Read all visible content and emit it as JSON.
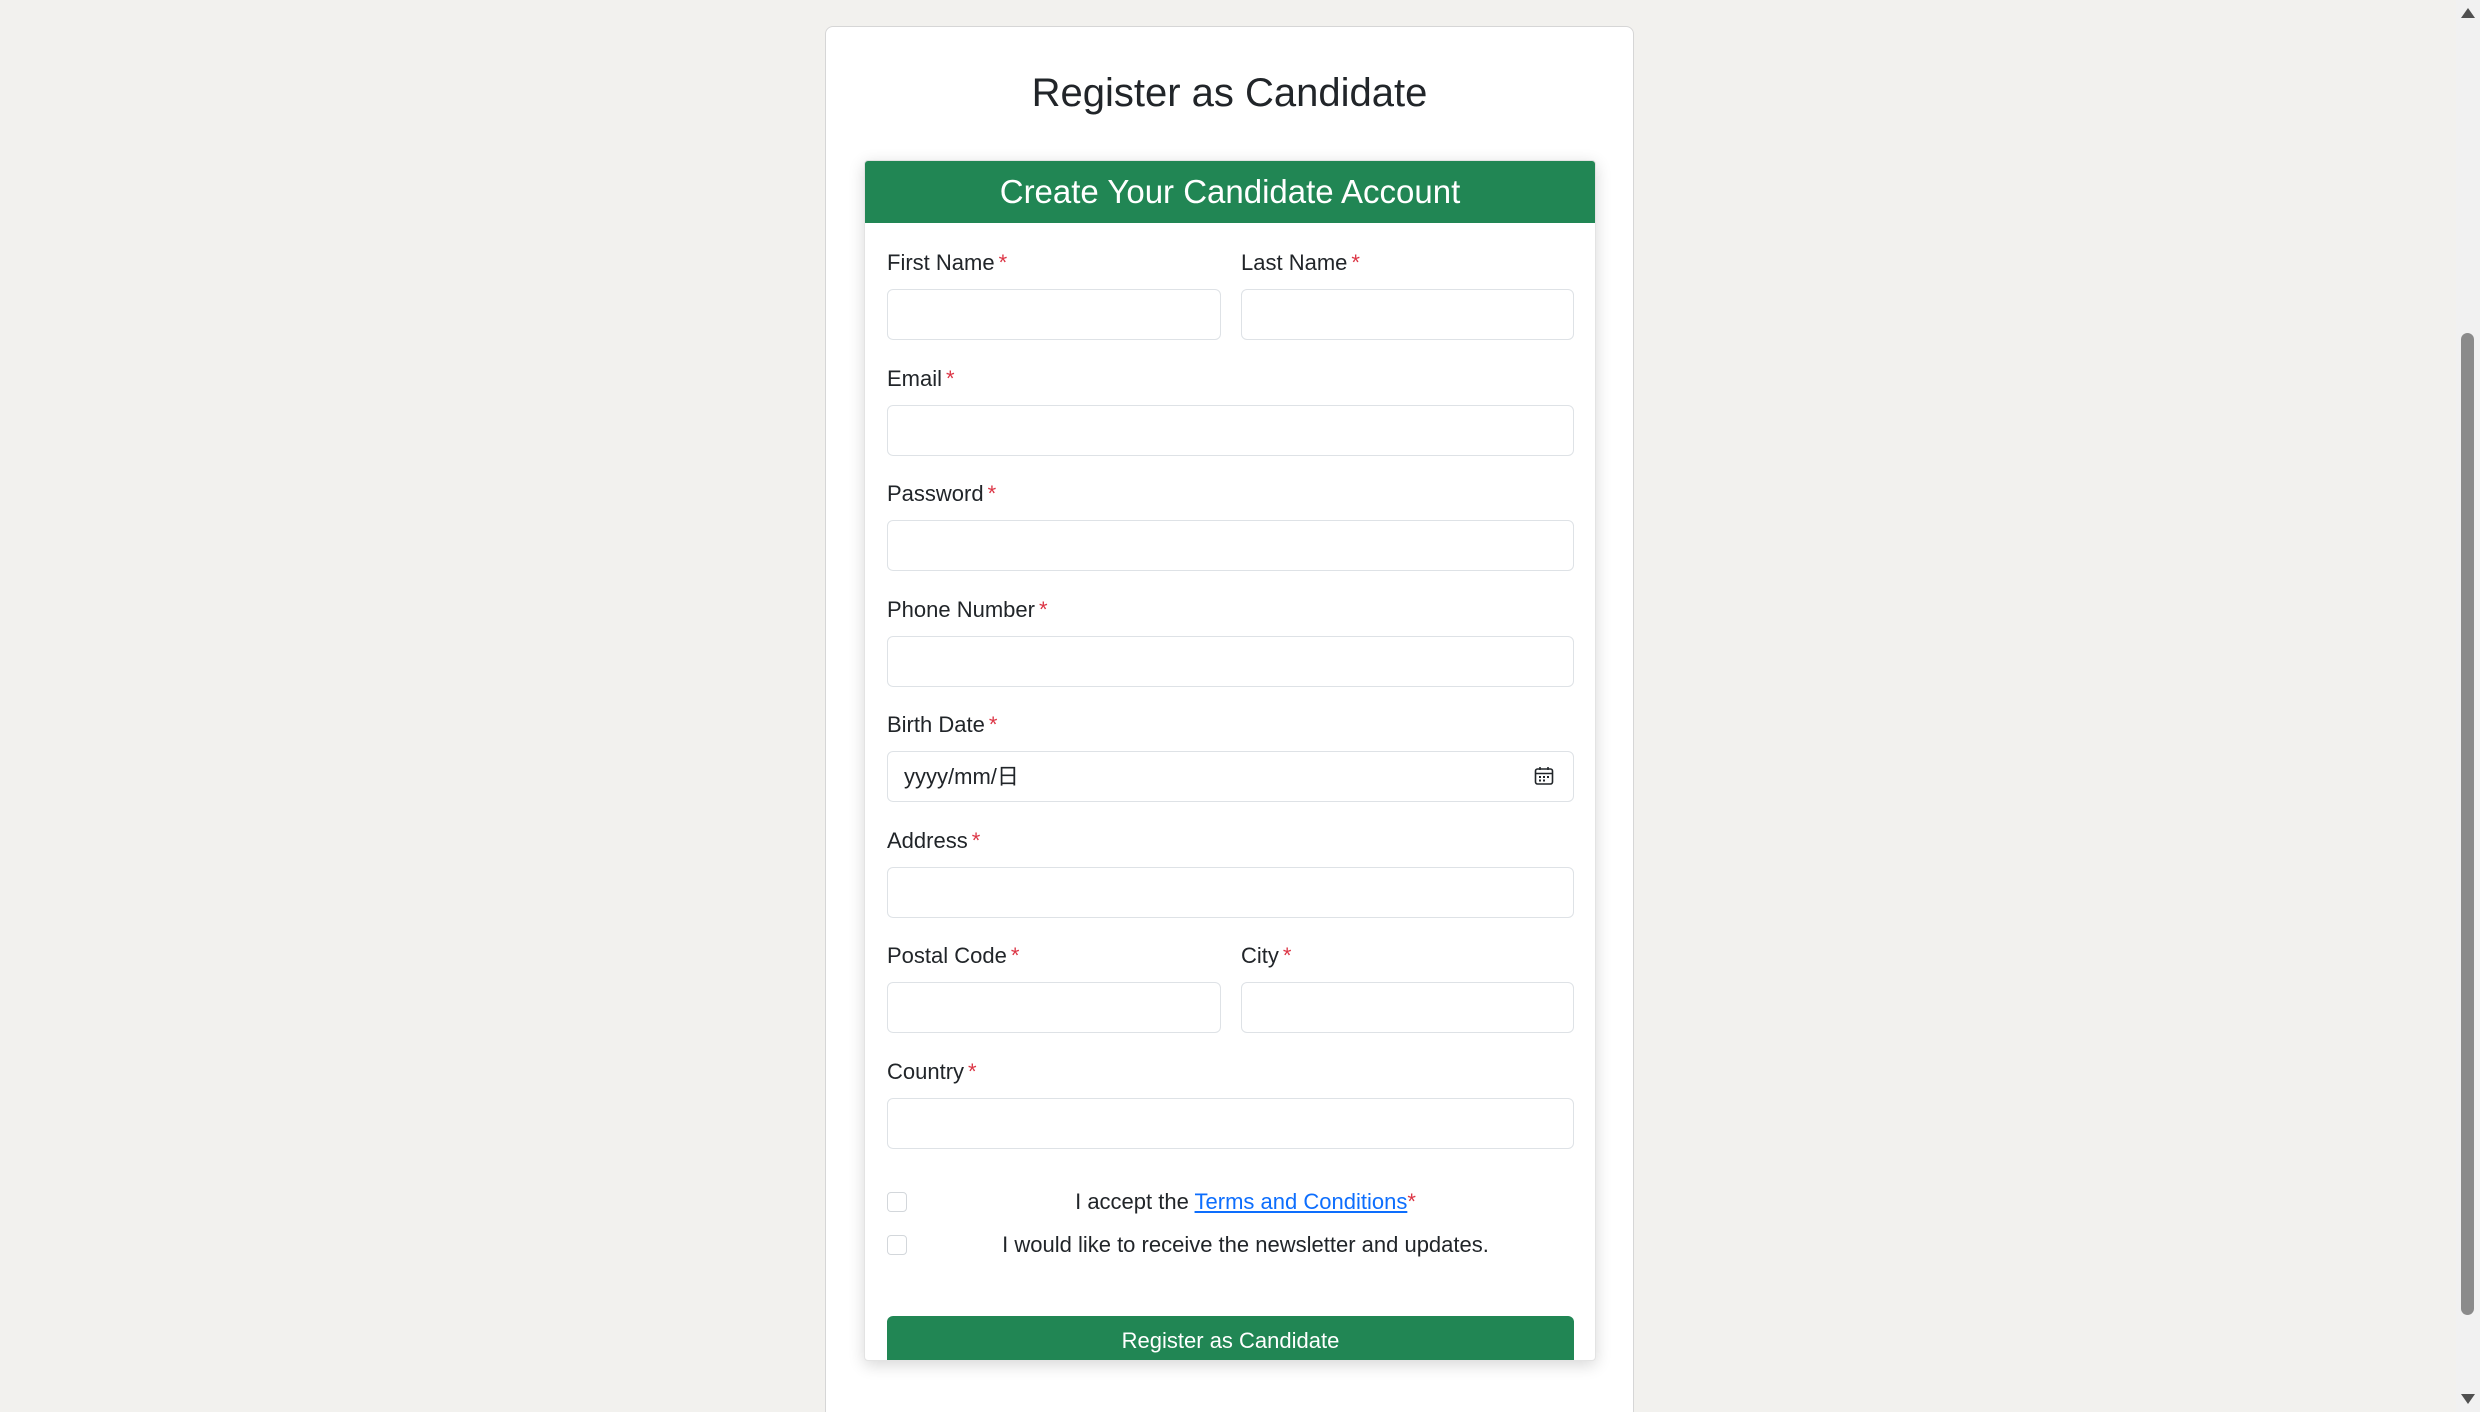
{
  "page": {
    "title": "Register as Candidate"
  },
  "form": {
    "header": "Create Your Candidate Account",
    "required_marker": "*",
    "fields": {
      "first_name": {
        "label": "First Name",
        "value": ""
      },
      "last_name": {
        "label": "Last Name",
        "value": ""
      },
      "email": {
        "label": "Email",
        "value": ""
      },
      "password": {
        "label": "Password",
        "value": ""
      },
      "phone_number": {
        "label": "Phone Number",
        "value": ""
      },
      "birth_date": {
        "label": "Birth Date",
        "placeholder": "yyyy/mm/日",
        "icon": "calendar-icon"
      },
      "address": {
        "label": "Address",
        "value": ""
      },
      "postal_code": {
        "label": "Postal Code",
        "value": ""
      },
      "city": {
        "label": "City",
        "value": ""
      },
      "country": {
        "label": "Country",
        "value": ""
      }
    },
    "terms": {
      "prefix": "I accept the ",
      "link": "Terms and Conditions",
      "checked": false
    },
    "newsletter": {
      "text": "I would like to receive the newsletter and updates.",
      "checked": false
    },
    "submit_label": "Register as Candidate"
  },
  "colors": {
    "brand_green": "#218654",
    "required_red": "#dc3545",
    "link_blue": "#0d6efd",
    "page_background": "#f2f1ee"
  }
}
